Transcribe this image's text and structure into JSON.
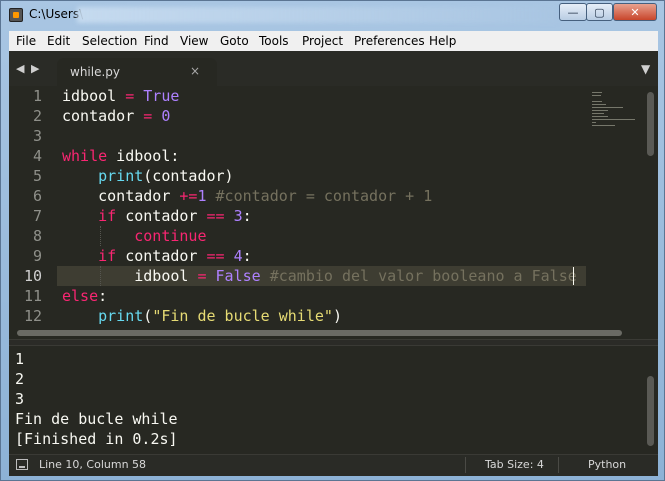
{
  "window": {
    "title": "C:\\Users\\",
    "minimize_symbol": "—",
    "maximize_symbol": "▢",
    "close_symbol": "✕"
  },
  "menu": [
    "File",
    "Edit",
    "Selection",
    "Find",
    "View",
    "Goto",
    "Tools",
    "Project",
    "Preferences",
    "Help"
  ],
  "tabs": {
    "nav_left": "◀",
    "nav_right": "▶",
    "active": {
      "label": "while.py",
      "close": "×"
    },
    "dropdown": "▼"
  },
  "editor": {
    "line_numbers": [
      "1",
      "2",
      "3",
      "4",
      "5",
      "6",
      "7",
      "8",
      "9",
      "10",
      "11",
      "12"
    ],
    "active_line": 10,
    "code": [
      [
        {
          "t": "idbool ",
          "c": ""
        },
        {
          "t": "=",
          "c": "kw"
        },
        {
          "t": " ",
          "c": ""
        },
        {
          "t": "True",
          "c": "num"
        }
      ],
      [
        {
          "t": "contador ",
          "c": ""
        },
        {
          "t": "=",
          "c": "kw"
        },
        {
          "t": " ",
          "c": ""
        },
        {
          "t": "0",
          "c": "num"
        }
      ],
      [],
      [
        {
          "t": "while",
          "c": "kw"
        },
        {
          "t": " idbool:",
          "c": ""
        }
      ],
      [
        {
          "t": "    ",
          "c": ""
        },
        {
          "t": "print",
          "c": "fn"
        },
        {
          "t": "(contador)",
          "c": ""
        }
      ],
      [
        {
          "t": "    contador ",
          "c": ""
        },
        {
          "t": "+=",
          "c": "kw"
        },
        {
          "t": "1",
          "c": "num"
        },
        {
          "t": " #contador = contador + 1",
          "c": "cm"
        }
      ],
      [
        {
          "t": "    ",
          "c": ""
        },
        {
          "t": "if",
          "c": "kw"
        },
        {
          "t": " contador ",
          "c": ""
        },
        {
          "t": "==",
          "c": "kw"
        },
        {
          "t": " ",
          "c": ""
        },
        {
          "t": "3",
          "c": "num"
        },
        {
          "t": ":",
          "c": ""
        }
      ],
      [
        {
          "t": "        ",
          "c": ""
        },
        {
          "t": "continue",
          "c": "kw"
        }
      ],
      [
        {
          "t": "    ",
          "c": ""
        },
        {
          "t": "if",
          "c": "kw"
        },
        {
          "t": " contador ",
          "c": ""
        },
        {
          "t": "==",
          "c": "kw"
        },
        {
          "t": " ",
          "c": ""
        },
        {
          "t": "4",
          "c": "num"
        },
        {
          "t": ":",
          "c": ""
        }
      ],
      [
        {
          "t": "        idbool ",
          "c": ""
        },
        {
          "t": "=",
          "c": "kw"
        },
        {
          "t": " ",
          "c": ""
        },
        {
          "t": "False",
          "c": "num"
        },
        {
          "t": " #cambio del valor booleano a False",
          "c": "cm"
        }
      ],
      [
        {
          "t": "else",
          "c": "kw"
        },
        {
          "t": ":",
          "c": ""
        }
      ],
      [
        {
          "t": "    ",
          "c": ""
        },
        {
          "t": "print",
          "c": "fn"
        },
        {
          "t": "(",
          "c": ""
        },
        {
          "t": "\"Fin de bucle while\"",
          "c": "str"
        },
        {
          "t": ")",
          "c": ""
        }
      ]
    ]
  },
  "output": {
    "lines": [
      "1",
      "2",
      "3",
      "Fin de bucle while",
      "[Finished in 0.2s]"
    ]
  },
  "status": {
    "position": "Line 10, Column 58",
    "tab_size": "Tab Size: 4",
    "syntax": "Python"
  },
  "colors": {
    "background": "#272822",
    "keyword": "#f92672",
    "function": "#66d9ef",
    "constant": "#ae81ff",
    "string": "#e6db74",
    "comment": "#75715e",
    "text": "#f8f8f2"
  }
}
